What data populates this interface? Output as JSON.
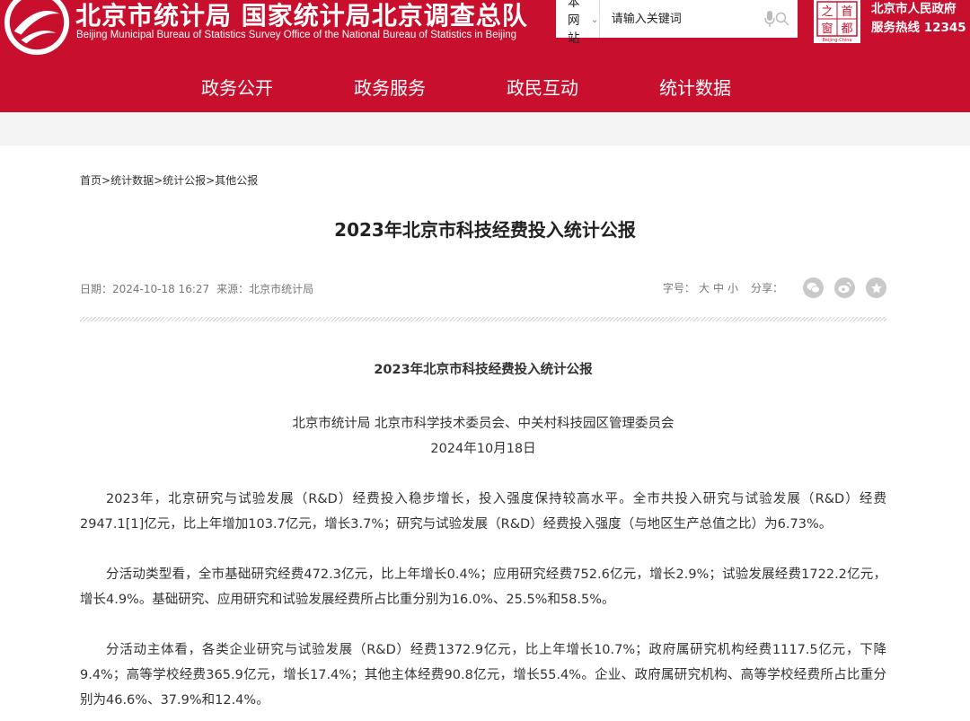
{
  "header": {
    "title": "北京市统计局 国家统计局北京调查总队",
    "subtitle": "Beijing Municipal Bureau of Statistics  Survey Office of the National Bureau of Statistics in Beijing",
    "search_scope": "本网站",
    "search_placeholder": "请输入关键词",
    "capital_logo": {
      "chars": [
        "之",
        "首",
        "窗",
        "都"
      ],
      "caption": "Beijing-China"
    },
    "gov_line1": "北京市人民政府",
    "gov_line2": "服务热线 12345",
    "colors": {
      "brand_red": "#c8102e"
    }
  },
  "nav": {
    "items": [
      "政务公开",
      "政务服务",
      "政民互动",
      "统计数据"
    ]
  },
  "breadcrumb": {
    "items": [
      "首页",
      "统计数据",
      "统计公报",
      "其他公报"
    ],
    "separator": ">"
  },
  "page": {
    "title": "2023年北京市科技经费投入统计公报",
    "date_label": "日期：2024-10-18 16:27",
    "source_label": "来源：北京市统计局",
    "font_size_label": "字号：",
    "font_sizes": [
      "大",
      "中",
      "小"
    ],
    "share_label": "分享："
  },
  "share_icons": [
    "wechat-icon",
    "weibo-icon",
    "favorite-icon"
  ],
  "article": {
    "title": "2023年北京市科技经费投入统计公报",
    "issuers": "北京市统计局  北京市科学技术委员会、中关村科技园区管理委员会",
    "date": "2024年10月18日",
    "paragraphs": [
      "2023年，北京研究与试验发展（R&D）经费投入稳步增长，投入强度保持较高水平。全市共投入研究与试验发展（R&D）经费2947.1[1]亿元，比上年增加103.7亿元，增长3.7%；研究与试验发展（R&D）经费投入强度（与地区生产总值之比）为6.73%。",
      "分活动类型看，全市基础研究经费472.3亿元，比上年增长0.4%；应用研究经费752.6亿元，增长2.9%；试验发展经费1722.2亿元，增长4.9%。基础研究、应用研究和试验发展经费所占比重分别为16.0%、25.5%和58.5%。",
      "分活动主体看，各类企业研究与试验发展（R&D）经费1372.9亿元，比上年增长10.7%；政府属研究机构经费1117.5亿元，下降9.4%；高等学校经费365.9亿元，增长17.4%；其他主体经费90.8亿元，增长55.4%。企业、政府属研究机构、高等学校经费所占比重分别为46.6%、37.9%和12.4%。"
    ]
  }
}
